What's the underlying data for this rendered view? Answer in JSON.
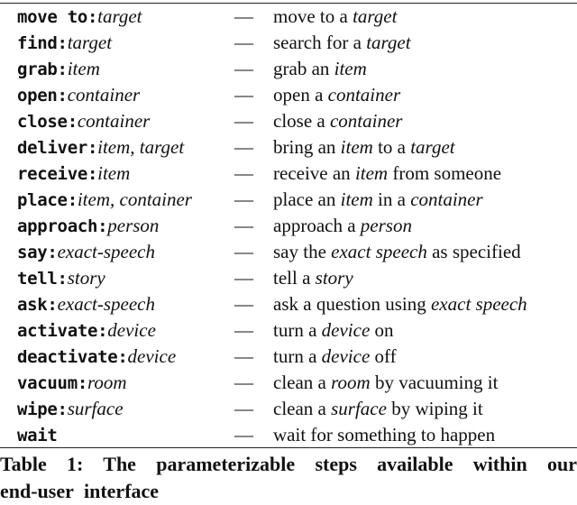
{
  "table": {
    "rows": [
      {
        "command": "move to:",
        "params": "target",
        "dash": "—",
        "desc": [
          {
            "t": "move to a ",
            "i": false
          },
          {
            "t": "target",
            "i": true
          }
        ]
      },
      {
        "command": "find:",
        "params": "target",
        "dash": "—",
        "desc": [
          {
            "t": "search for a ",
            "i": false
          },
          {
            "t": "target",
            "i": true
          }
        ]
      },
      {
        "command": "grab:",
        "params": "item",
        "dash": "—",
        "desc": [
          {
            "t": "grab an ",
            "i": false
          },
          {
            "t": "item",
            "i": true
          }
        ]
      },
      {
        "command": "open:",
        "params": "container",
        "dash": "—",
        "desc": [
          {
            "t": "open a ",
            "i": false
          },
          {
            "t": "container",
            "i": true
          }
        ]
      },
      {
        "command": "close:",
        "params": "container",
        "dash": "—",
        "desc": [
          {
            "t": "close a ",
            "i": false
          },
          {
            "t": "container",
            "i": true
          }
        ]
      },
      {
        "command": "deliver:",
        "params": "item, target",
        "dash": "—",
        "desc": [
          {
            "t": "bring an ",
            "i": false
          },
          {
            "t": "item",
            "i": true
          },
          {
            "t": " to a ",
            "i": false
          },
          {
            "t": "target",
            "i": true
          }
        ]
      },
      {
        "command": "receive:",
        "params": "item",
        "dash": "—",
        "desc": [
          {
            "t": "receive an ",
            "i": false
          },
          {
            "t": "item",
            "i": true
          },
          {
            "t": " from someone",
            "i": false
          }
        ]
      },
      {
        "command": "place:",
        "params": "item, container",
        "dash": "—",
        "desc": [
          {
            "t": "place an ",
            "i": false
          },
          {
            "t": "item",
            "i": true
          },
          {
            "t": " in a ",
            "i": false
          },
          {
            "t": "container",
            "i": true
          }
        ]
      },
      {
        "command": "approach:",
        "params": "person",
        "dash": "—",
        "desc": [
          {
            "t": "approach a ",
            "i": false
          },
          {
            "t": "person",
            "i": true
          }
        ]
      },
      {
        "command": "say:",
        "params": "exact-speech",
        "dash": "—",
        "desc": [
          {
            "t": "say the ",
            "i": false
          },
          {
            "t": "exact speech",
            "i": true
          },
          {
            "t": " as specified",
            "i": false
          }
        ]
      },
      {
        "command": "tell:",
        "params": "story",
        "dash": "—",
        "desc": [
          {
            "t": "tell a ",
            "i": false
          },
          {
            "t": "story",
            "i": true
          }
        ]
      },
      {
        "command": "ask:",
        "params": "exact-speech",
        "dash": "—",
        "desc": [
          {
            "t": "ask a question using ",
            "i": false
          },
          {
            "t": "exact speech",
            "i": true
          }
        ]
      },
      {
        "command": "activate:",
        "params": "device",
        "dash": "—",
        "desc": [
          {
            "t": "turn a ",
            "i": false
          },
          {
            "t": "device",
            "i": true
          },
          {
            "t": " on",
            "i": false
          }
        ]
      },
      {
        "command": "deactivate:",
        "params": "device",
        "dash": "—",
        "desc": [
          {
            "t": "turn a ",
            "i": false
          },
          {
            "t": "device",
            "i": true
          },
          {
            "t": " off",
            "i": false
          }
        ]
      },
      {
        "command": "vacuum:",
        "params": "room",
        "dash": "—",
        "desc": [
          {
            "t": "clean a ",
            "i": false
          },
          {
            "t": "room",
            "i": true
          },
          {
            "t": " by vacuuming it",
            "i": false
          }
        ]
      },
      {
        "command": "wipe:",
        "params": "surface",
        "dash": "—",
        "desc": [
          {
            "t": "clean a ",
            "i": false
          },
          {
            "t": "surface",
            "i": true
          },
          {
            "t": " by wiping it",
            "i": false
          }
        ]
      },
      {
        "command": "wait",
        "params": "",
        "dash": "—",
        "desc": [
          {
            "t": "wait for something to happen",
            "i": false
          }
        ]
      }
    ]
  },
  "caption": {
    "line1": "Table 1: The parameterizable steps available within our",
    "line2": "end-user interface"
  }
}
